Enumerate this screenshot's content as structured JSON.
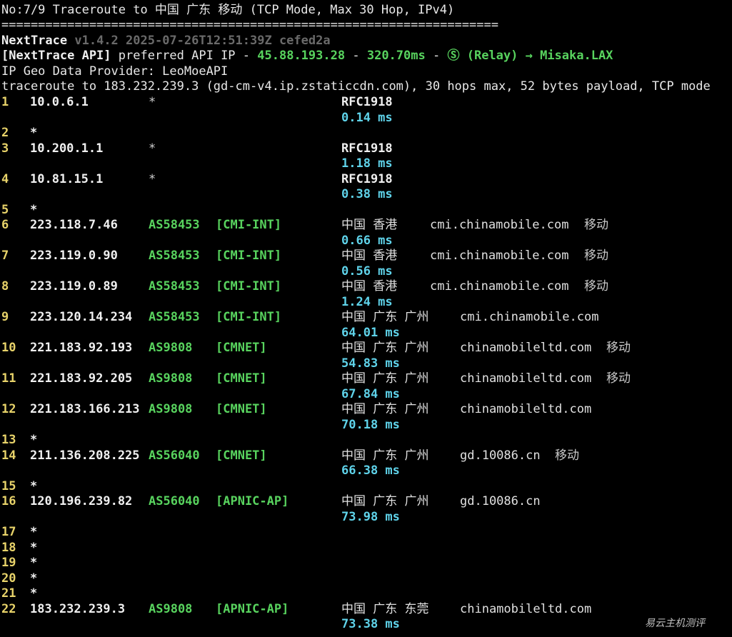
{
  "header": {
    "title_line": "No:7/9 Traceroute to 中国 广东 移动 (TCP Mode, Max 30 Hop, IPv4)",
    "separator": "====================================================================",
    "app_name": "NextTrace",
    "version_info": "v1.4.2 2025-07-26T12:51:39Z cefed2a",
    "api_prefix": "[NextTrace API]",
    "api_text": "preferred API IP -",
    "api_ip": "45.88.193.28",
    "api_dash1": "-",
    "api_latency": "320.70ms",
    "api_dash2": "-",
    "api_relay": "Ⓢ (Relay) → Misaka.LAX",
    "geo_provider": "IP Geo Data Provider: LeoMoeAPI",
    "traceroute_line": "traceroute to 183.232.239.3 (gd-cm-v4.ip.zstaticcdn.com), 30 hops max, 52 bytes payload, TCP mode"
  },
  "hops": [
    {
      "num": "1",
      "ip": "10.0.6.1",
      "as": "",
      "star": "*",
      "tag": "",
      "geo": "RFC1918",
      "host": "",
      "isp": "",
      "latency": "0.14 ms",
      "rfc": true
    },
    {
      "num": "2",
      "ip": "*",
      "timeout": true
    },
    {
      "num": "3",
      "ip": "10.200.1.1",
      "as": "",
      "star": "*",
      "tag": "",
      "geo": "RFC1918",
      "host": "",
      "isp": "",
      "latency": "1.18 ms",
      "rfc": true
    },
    {
      "num": "4",
      "ip": "10.81.15.1",
      "as": "",
      "star": "*",
      "tag": "",
      "geo": "RFC1918",
      "host": "",
      "isp": "",
      "latency": "0.38 ms",
      "rfc": true
    },
    {
      "num": "5",
      "ip": "*",
      "timeout": true
    },
    {
      "num": "6",
      "ip": "223.118.7.46",
      "as": "AS58453",
      "tag": "[CMI-INT]",
      "geo": "中国 香港",
      "host": "cmi.chinamobile.com",
      "isp": "移动",
      "latency": "0.66 ms"
    },
    {
      "num": "7",
      "ip": "223.119.0.90",
      "as": "AS58453",
      "tag": "[CMI-INT]",
      "geo": "中国 香港",
      "host": "cmi.chinamobile.com",
      "isp": "移动",
      "latency": "0.56 ms"
    },
    {
      "num": "8",
      "ip": "223.119.0.89",
      "as": "AS58453",
      "tag": "[CMI-INT]",
      "geo": "中国 香港",
      "host": "cmi.chinamobile.com",
      "isp": "移动",
      "latency": "1.24 ms"
    },
    {
      "num": "9",
      "ip": "223.120.14.234",
      "as": "AS58453",
      "tag": "[CMI-INT]",
      "geo": "中国 广东 广州",
      "host": "cmi.chinamobile.com",
      "isp": "",
      "latency": "64.01 ms"
    },
    {
      "num": "10",
      "ip": "221.183.92.193",
      "as": "AS9808",
      "tag": "[CMNET]",
      "geo": "中国 广东 广州",
      "host": "chinamobileltd.com",
      "isp": "移动",
      "latency": "54.83 ms"
    },
    {
      "num": "11",
      "ip": "221.183.92.205",
      "as": "AS9808",
      "tag": "[CMNET]",
      "geo": "中国 广东 广州",
      "host": "chinamobileltd.com",
      "isp": "移动",
      "latency": "67.84 ms"
    },
    {
      "num": "12",
      "ip": "221.183.166.213",
      "as": "AS9808",
      "tag": "[CMNET]",
      "geo": "中国 广东 广州",
      "host": "chinamobileltd.com",
      "isp": "",
      "latency": "70.18 ms"
    },
    {
      "num": "13",
      "ip": "*",
      "timeout": true
    },
    {
      "num": "14",
      "ip": "211.136.208.225",
      "as": "AS56040",
      "tag": "[CMNET]",
      "geo": "中国 广东 广州",
      "host": "gd.10086.cn",
      "isp": "移动",
      "latency": "66.38 ms"
    },
    {
      "num": "15",
      "ip": "*",
      "timeout": true
    },
    {
      "num": "16",
      "ip": "120.196.239.82",
      "as": "AS56040",
      "tag": "[APNIC-AP]",
      "geo": "中国 广东 广州",
      "host": "gd.10086.cn",
      "isp": "",
      "latency": "73.98 ms"
    },
    {
      "num": "17",
      "ip": "*",
      "timeout": true
    },
    {
      "num": "18",
      "ip": "*",
      "timeout": true
    },
    {
      "num": "19",
      "ip": "*",
      "timeout": true
    },
    {
      "num": "20",
      "ip": "*",
      "timeout": true
    },
    {
      "num": "21",
      "ip": "*",
      "timeout": true
    },
    {
      "num": "22",
      "ip": "183.232.239.3",
      "as": "AS9808",
      "tag": "[APNIC-AP]",
      "geo": "中国 广东 东莞",
      "host": "chinamobileltd.com",
      "isp": "",
      "latency": "73.38 ms"
    }
  ],
  "watermark": "易云主机测评"
}
